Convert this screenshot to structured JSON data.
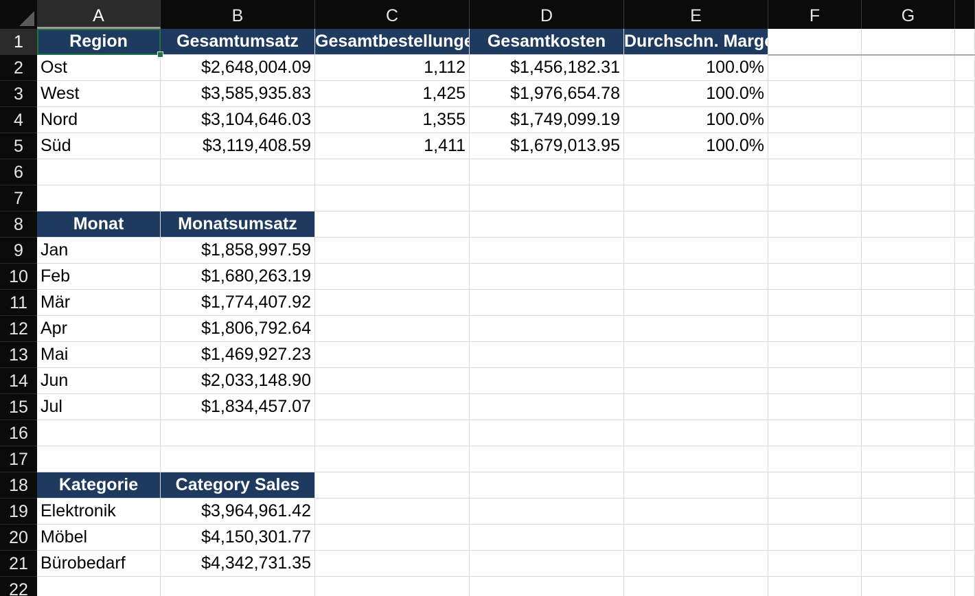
{
  "sheet": {
    "columns": [
      "A",
      "B",
      "C",
      "D",
      "E",
      "F",
      "G"
    ],
    "rows": [
      "1",
      "2",
      "3",
      "4",
      "5",
      "6",
      "7",
      "8",
      "9",
      "10",
      "11",
      "12",
      "13",
      "14",
      "15",
      "16",
      "17",
      "18",
      "19",
      "20",
      "21",
      "22"
    ],
    "active_cell": "A1",
    "cells": {
      "A1": {
        "v": "Region",
        "s": "hdr"
      },
      "B1": {
        "v": "Gesamtumsatz",
        "s": "hdr"
      },
      "C1": {
        "v": "Gesamtbestellungen",
        "s": "hdr"
      },
      "D1": {
        "v": "Gesamtkosten",
        "s": "hdr"
      },
      "E1": {
        "v": "Durchschn. Marge",
        "s": "hdr"
      },
      "A2": {
        "v": "Ost",
        "s": "txt"
      },
      "B2": {
        "v": "$2,648,004.09",
        "s": "num"
      },
      "C2": {
        "v": "1,112",
        "s": "num"
      },
      "D2": {
        "v": "$1,456,182.31",
        "s": "num"
      },
      "E2": {
        "v": "100.0%",
        "s": "num"
      },
      "A3": {
        "v": "West",
        "s": "txt"
      },
      "B3": {
        "v": "$3,585,935.83",
        "s": "num"
      },
      "C3": {
        "v": "1,425",
        "s": "num"
      },
      "D3": {
        "v": "$1,976,654.78",
        "s": "num"
      },
      "E3": {
        "v": "100.0%",
        "s": "num"
      },
      "A4": {
        "v": "Nord",
        "s": "txt"
      },
      "B4": {
        "v": "$3,104,646.03",
        "s": "num"
      },
      "C4": {
        "v": "1,355",
        "s": "num"
      },
      "D4": {
        "v": "$1,749,099.19",
        "s": "num"
      },
      "E4": {
        "v": "100.0%",
        "s": "num"
      },
      "A5": {
        "v": "Süd",
        "s": "txt"
      },
      "B5": {
        "v": "$3,119,408.59",
        "s": "num"
      },
      "C5": {
        "v": "1,411",
        "s": "num"
      },
      "D5": {
        "v": "$1,679,013.95",
        "s": "num"
      },
      "E5": {
        "v": "100.0%",
        "s": "num"
      },
      "A8": {
        "v": "Monat",
        "s": "hdr"
      },
      "B8": {
        "v": "Monatsumsatz",
        "s": "hdr"
      },
      "A9": {
        "v": "Jan",
        "s": "txt"
      },
      "B9": {
        "v": "$1,858,997.59",
        "s": "num"
      },
      "A10": {
        "v": "Feb",
        "s": "txt"
      },
      "B10": {
        "v": "$1,680,263.19",
        "s": "num"
      },
      "A11": {
        "v": "Mär",
        "s": "txt"
      },
      "B11": {
        "v": "$1,774,407.92",
        "s": "num"
      },
      "A12": {
        "v": "Apr",
        "s": "txt"
      },
      "B12": {
        "v": "$1,806,792.64",
        "s": "num"
      },
      "A13": {
        "v": "Mai",
        "s": "txt"
      },
      "B13": {
        "v": "$1,469,927.23",
        "s": "num"
      },
      "A14": {
        "v": "Jun",
        "s": "txt"
      },
      "B14": {
        "v": "$2,033,148.90",
        "s": "num"
      },
      "A15": {
        "v": "Jul",
        "s": "txt"
      },
      "B15": {
        "v": "$1,834,457.07",
        "s": "num"
      },
      "A18": {
        "v": "Kategorie",
        "s": "hdr"
      },
      "B18": {
        "v": "Category Sales",
        "s": "hdr"
      },
      "A19": {
        "v": "Elektronik",
        "s": "txt"
      },
      "B19": {
        "v": "$3,964,961.42",
        "s": "num"
      },
      "A20": {
        "v": "Möbel",
        "s": "txt"
      },
      "B20": {
        "v": "$4,150,301.77",
        "s": "num"
      },
      "A21": {
        "v": "Bürobedarf",
        "s": "txt"
      },
      "B21": {
        "v": "$4,342,731.35",
        "s": "num"
      }
    }
  },
  "colors": {
    "header_fill": "#1f3a5f",
    "header_text": "#ffffff",
    "selection_border": "#217346",
    "chrome_bg": "#0b0b0b"
  },
  "icons": {
    "select_all": "select-all-triangle-icon"
  }
}
